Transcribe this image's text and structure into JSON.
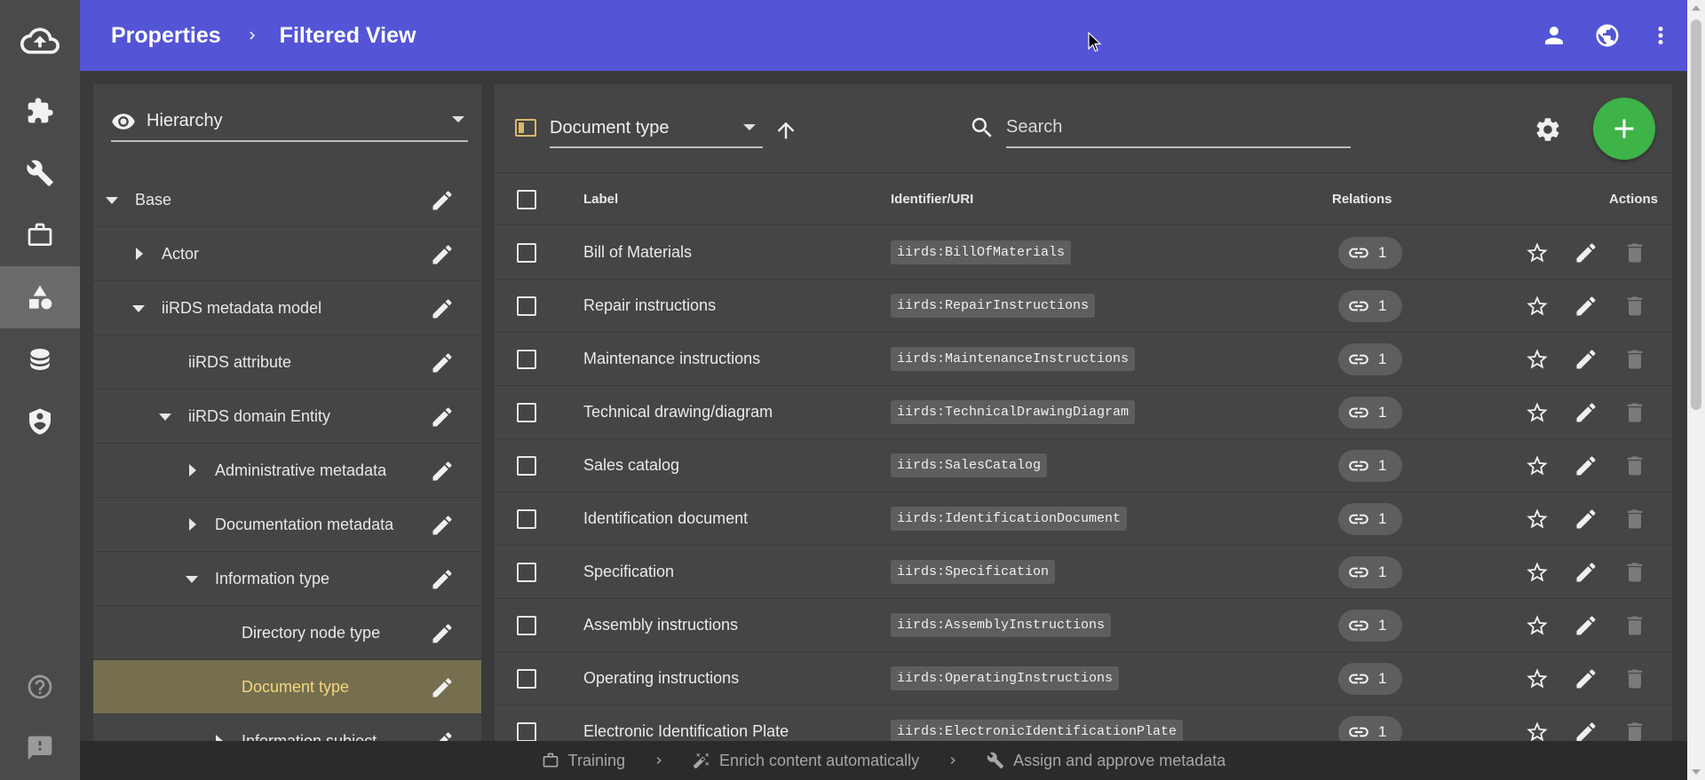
{
  "header": {
    "breadcrumb": [
      "Properties",
      "Filtered View"
    ],
    "icons": [
      "person-icon",
      "globe-icon",
      "more-vert-icon"
    ],
    "color": "#5355d6"
  },
  "rail": {
    "items": [
      "cloud-upload-icon",
      "puzzle-icon",
      "wrench-icon",
      "briefcase-icon",
      "shapes-icon",
      "database-icon",
      "shield-person-icon",
      "help-icon",
      "feedback-icon"
    ],
    "active": "shapes-icon"
  },
  "left_panel": {
    "view_selector": "Hierarchy",
    "tree": [
      {
        "label": "Base",
        "toggle": "down",
        "level": 0
      },
      {
        "label": "Actor",
        "toggle": "right",
        "level": 1
      },
      {
        "label": "iiRDS metadata model",
        "toggle": "down",
        "level": 1
      },
      {
        "label": "iiRDS attribute",
        "toggle": "none",
        "level": 2
      },
      {
        "label": "iiRDS domain Entity",
        "toggle": "down",
        "level": 2
      },
      {
        "label": "Administrative metadata",
        "toggle": "right",
        "level": 3
      },
      {
        "label": "Documentation metadata",
        "toggle": "right",
        "level": 3
      },
      {
        "label": "Information type",
        "toggle": "down",
        "level": 3
      },
      {
        "label": "Directory node type",
        "toggle": "none",
        "level": 4
      },
      {
        "label": "Document type",
        "toggle": "none",
        "level": 4,
        "selected": true
      },
      {
        "label": "Information subject",
        "toggle": "right",
        "level": 4
      }
    ]
  },
  "right_panel": {
    "type_selector": "Document type",
    "search_placeholder": "Search",
    "columns": {
      "label": "Label",
      "uri": "Identifier/URI",
      "relations": "Relations",
      "actions": "Actions"
    },
    "rows": [
      {
        "label": "Bill of Materials",
        "uri": "iirds:BillOfMaterials",
        "relations": "1"
      },
      {
        "label": "Repair instructions",
        "uri": "iirds:RepairInstructions",
        "relations": "1"
      },
      {
        "label": "Maintenance instructions",
        "uri": "iirds:MaintenanceInstructions",
        "relations": "1"
      },
      {
        "label": "Technical drawing/diagram",
        "uri": "iirds:TechnicalDrawingDiagram",
        "relations": "1"
      },
      {
        "label": "Sales catalog",
        "uri": "iirds:SalesCatalog",
        "relations": "1"
      },
      {
        "label": "Identification document",
        "uri": "iirds:IdentificationDocument",
        "relations": "1"
      },
      {
        "label": "Specification",
        "uri": "iirds:Specification",
        "relations": "1"
      },
      {
        "label": "Assembly instructions",
        "uri": "iirds:AssemblyInstructions",
        "relations": "1"
      },
      {
        "label": "Operating instructions",
        "uri": "iirds:OperatingInstructions",
        "relations": "1"
      },
      {
        "label": "Electronic Identification Plate",
        "uri": "iirds:ElectronicIdentificationPlate",
        "relations": "1"
      }
    ],
    "accent": "#3db348"
  },
  "bottom_bar": {
    "steps": [
      "Training",
      "Enrich content automatically",
      "Assign and approve metadata"
    ]
  }
}
